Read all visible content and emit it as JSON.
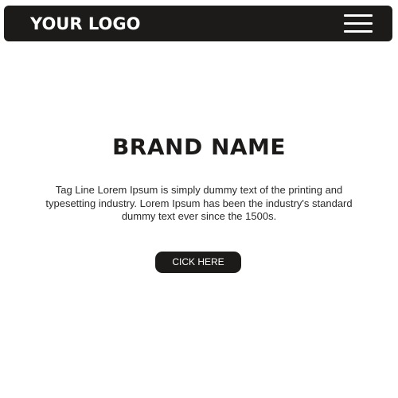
{
  "header": {
    "logo_text": "YOUR LOGO",
    "menu_icon": "hamburger-menu-icon"
  },
  "hero": {
    "brand_name": "BRAND NAME",
    "tagline": "Tag Line Lorem Ipsum is simply dummy text of the printing and typesetting industry. Lorem Ipsum has been the industry's standard dummy text ever since the 1500s.",
    "cta_label": "CICK HERE"
  },
  "colors": {
    "background": "#ffffff",
    "navbar": "#1c1b19",
    "accent_text": "#ffffff",
    "primary_text": "#1c1b19"
  }
}
